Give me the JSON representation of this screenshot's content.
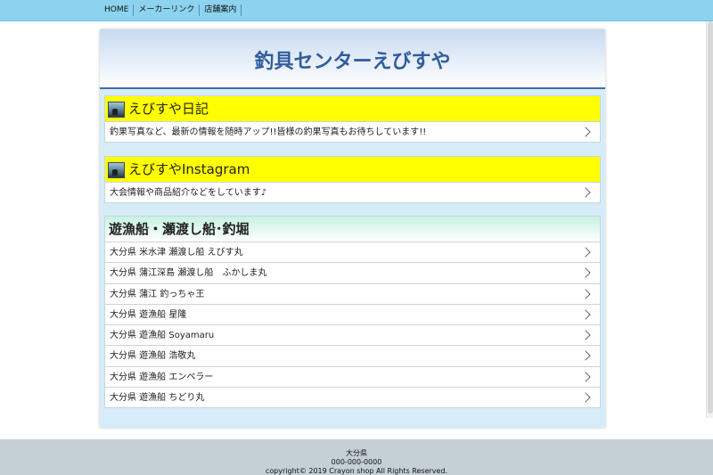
{
  "nav": {
    "items": [
      "HOME",
      "メーカーリンク",
      "店舗案内"
    ]
  },
  "header": {
    "title": "釣具センターえびすや"
  },
  "sections": [
    {
      "title": "えびすや日記",
      "rows": [
        "釣果写真など、最新の情報を随時アップ!!皆様の釣果写真もお待ちしています!!"
      ]
    },
    {
      "title": "えびすやInstagram",
      "rows": [
        "大会情報や商品紹介などをしています♪"
      ]
    },
    {
      "title": "遊漁船・瀬渡し船･釣堀",
      "rows": [
        "大分県 米水津 瀬渡し船 えびす丸",
        "大分県 蒲江深島 瀬渡し船　ふかしま丸",
        "大分県 蒲江 釣っちゃ王",
        "大分県 遊漁船 星隆",
        "大分県 遊漁船 Soyamaru",
        "大分県 遊漁船 浩敬丸",
        "大分県 遊漁船 エンペラー",
        "大分県 遊漁船 ちどり丸"
      ]
    }
  ],
  "footer": {
    "line1": "大分県",
    "line2": "000-000-0000",
    "line3": "copyright© 2019 Crayon shop All Rights Reserved."
  },
  "colors": {
    "nav_bg": "#8cd3f0",
    "title": "#2f5d9e",
    "highlight": "#ffff00"
  }
}
